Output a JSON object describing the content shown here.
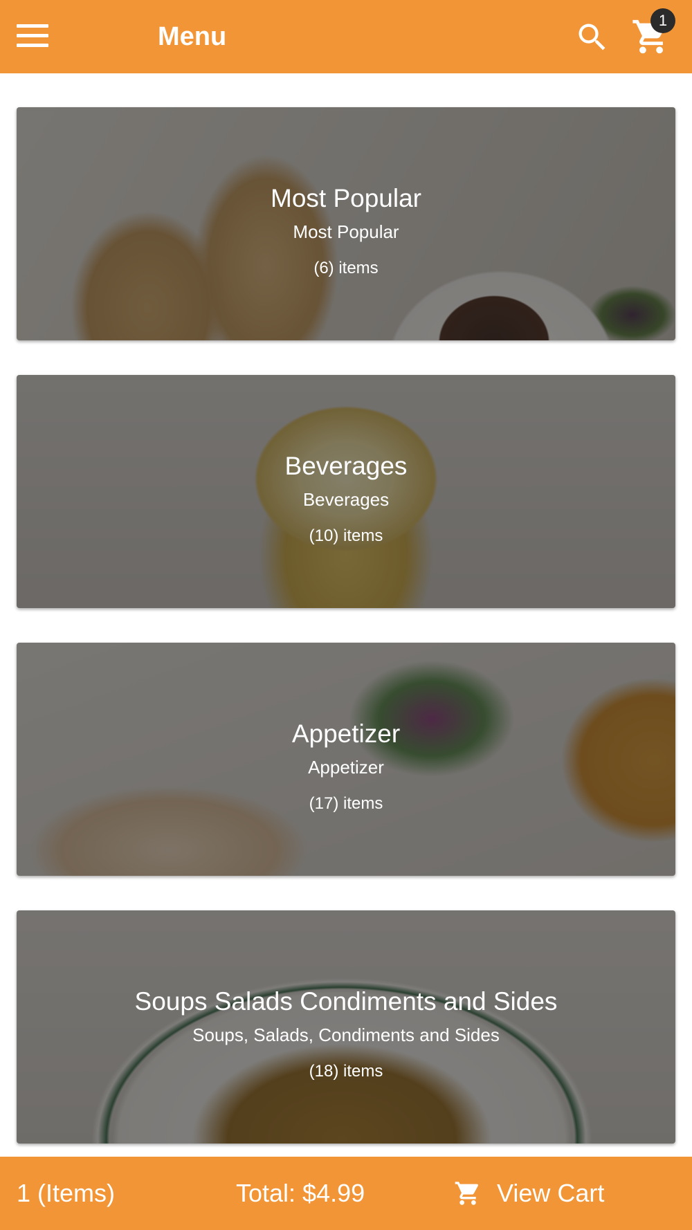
{
  "header": {
    "title": "Menu",
    "cart_count": "1"
  },
  "categories": [
    {
      "name": "Most Popular",
      "description": "Most Popular",
      "count": "(6) items"
    },
    {
      "name": "Beverages",
      "description": "Beverages",
      "count": "(10) items"
    },
    {
      "name": "Appetizer",
      "description": "Appetizer",
      "count": "(17) items"
    },
    {
      "name": "Soups Salads Condiments and Sides",
      "description": "Soups, Salads, Condiments and Sides",
      "count": "(18) items"
    }
  ],
  "footer": {
    "items": "1 (Items)",
    "total": "Total: $4.99",
    "view_cart": "View Cart"
  },
  "icons": {
    "menu": "menu-icon",
    "search": "search-icon",
    "cart": "cart-icon"
  },
  "colors": {
    "accent": "#f29536",
    "badge": "#2b2b2b"
  }
}
